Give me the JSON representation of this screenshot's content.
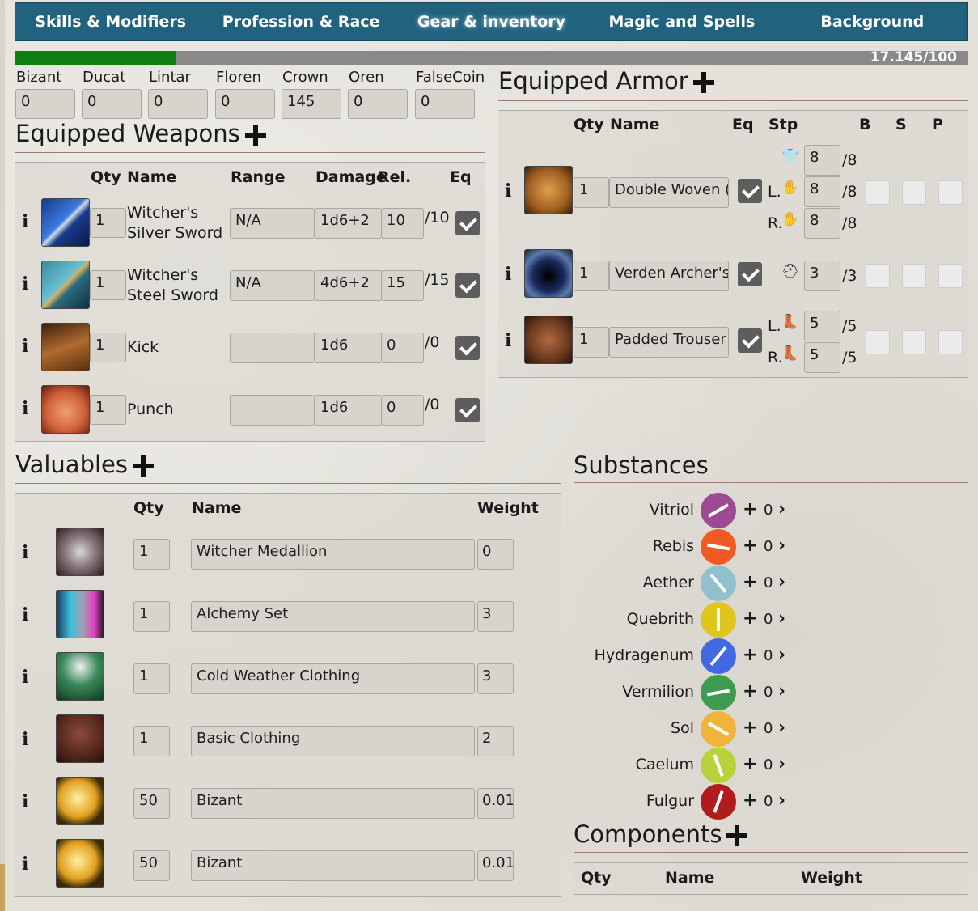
{
  "nav": {
    "tabs": [
      {
        "label": "Skills & Modifiers"
      },
      {
        "label": "Profession & Race"
      },
      {
        "label": "Gear & inventory"
      },
      {
        "label": "Magic and Spells"
      },
      {
        "label": "Background"
      }
    ]
  },
  "encumbrance": {
    "text": "17.145/100",
    "progress": 0.17
  },
  "coins": [
    {
      "label": "Bizant",
      "value": "0"
    },
    {
      "label": "Ducat",
      "value": "0"
    },
    {
      "label": "Lintar",
      "value": "0"
    },
    {
      "label": "Floren",
      "value": "0"
    },
    {
      "label": "Crown",
      "value": "145"
    },
    {
      "label": "Oren",
      "value": "0"
    },
    {
      "label": "FalseCoin",
      "value": "0"
    }
  ],
  "weapons": {
    "title": "Equipped Weapons",
    "headers": {
      "qty": "Qty",
      "name": "Name",
      "range": "Range",
      "damage": "Damage",
      "rel": "Rel.",
      "eq": "Eq"
    },
    "rows": [
      {
        "qty": "1",
        "name1": "Witcher's",
        "name2": "Silver Sword",
        "range": "N/A",
        "damage": "1d6+2",
        "rel": "10",
        "relmax": "/10",
        "icon": "silver-sword-icon"
      },
      {
        "qty": "1",
        "name1": "Witcher's",
        "name2": "Steel Sword",
        "range": "N/A",
        "damage": "4d6+2",
        "rel": "15",
        "relmax": "/15",
        "icon": "steel-sword-icon"
      },
      {
        "qty": "1",
        "name1": "Kick",
        "name2": "",
        "range": "",
        "damage": "1d6",
        "rel": "0",
        "relmax": "/0",
        "icon": "boot-icon"
      },
      {
        "qty": "1",
        "name1": "Punch",
        "name2": "",
        "range": "",
        "damage": "1d6",
        "rel": "0",
        "relmax": "/0",
        "icon": "fist-icon"
      }
    ]
  },
  "armor": {
    "title": "Equipped Armor",
    "headers": {
      "qty": "Qty",
      "name": "Name",
      "eq": "Eq",
      "stp": "Stp",
      "b": "B",
      "s": "S",
      "p": "P"
    },
    "rows": [
      {
        "qty": "1",
        "name": "Double Woven (",
        "stp": [
          {
            "label": "",
            "icon": "shirt-icon",
            "value": "8",
            "max": "/8"
          },
          {
            "label": "L.",
            "icon": "hand-icon",
            "value": "8",
            "max": "/8"
          },
          {
            "label": "R.",
            "icon": "hand-icon",
            "value": "8",
            "max": "/8"
          }
        ]
      },
      {
        "qty": "1",
        "name": "Verden Archer's",
        "stp": [
          {
            "label": "",
            "icon": "helmet-icon",
            "value": "3",
            "max": "/3"
          }
        ]
      },
      {
        "qty": "1",
        "name": "Padded Trouser",
        "stp": [
          {
            "label": "L.",
            "icon": "boot-icon",
            "value": "5",
            "max": "/5"
          },
          {
            "label": "R.",
            "icon": "boot-icon",
            "value": "5",
            "max": "/5"
          }
        ]
      }
    ]
  },
  "valuables": {
    "title": "Valuables",
    "headers": {
      "qty": "Qty",
      "name": "Name",
      "weight": "Weight"
    },
    "rows": [
      {
        "qty": "1",
        "name": "Witcher Medallion",
        "weight": "0",
        "icon": "medallion-icon"
      },
      {
        "qty": "1",
        "name": "Alchemy Set",
        "weight": "3",
        "icon": "alchemy-set-icon"
      },
      {
        "qty": "1",
        "name": "Cold Weather Clothing",
        "weight": "3",
        "icon": "cloak-icon"
      },
      {
        "qty": "1",
        "name": "Basic Clothing",
        "weight": "2",
        "icon": "clothing-icon"
      },
      {
        "qty": "50",
        "name": "Bizant",
        "weight": "0.01",
        "icon": "coin-icon"
      },
      {
        "qty": "50",
        "name": "Bizant",
        "weight": "0.01",
        "icon": "coin-icon"
      }
    ]
  },
  "substances": {
    "title": "Substances",
    "items": [
      {
        "name": "Vitriol",
        "count": "0",
        "color": "#9b4a93"
      },
      {
        "name": "Rebis",
        "count": "0",
        "color": "#f15a24"
      },
      {
        "name": "Aether",
        "count": "0",
        "color": "#8fc0cc"
      },
      {
        "name": "Quebrith",
        "count": "0",
        "color": "#e0c51c"
      },
      {
        "name": "Hydragenum",
        "count": "0",
        "color": "#4169e1"
      },
      {
        "name": "Vermilion",
        "count": "0",
        "color": "#3e9b4f"
      },
      {
        "name": "Sol",
        "count": "0",
        "color": "#f0b43a"
      },
      {
        "name": "Caelum",
        "count": "0",
        "color": "#b8d33a"
      },
      {
        "name": "Fulgur",
        "count": "0",
        "color": "#b01c1c"
      }
    ]
  },
  "components": {
    "title": "Components",
    "headers": {
      "qty": "Qty",
      "name": "Name",
      "weight": "Weight"
    }
  }
}
